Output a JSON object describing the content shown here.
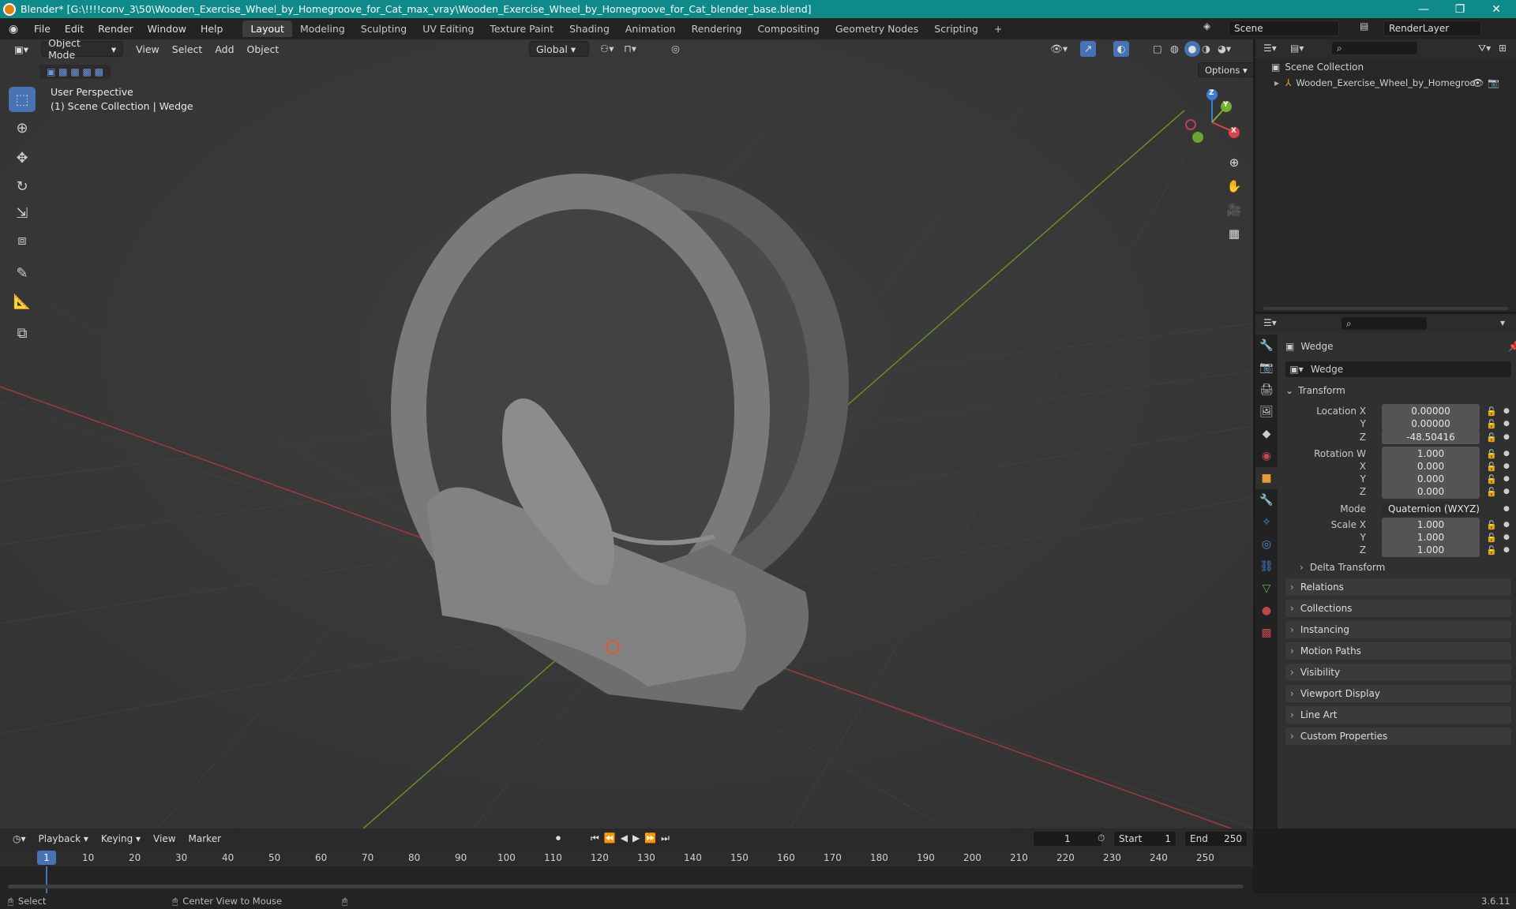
{
  "titlebar": {
    "title": "Blender* [G:\\!!!!conv_3\\50\\Wooden_Exercise_Wheel_by_Homegroove_for_Cat_max_vray\\Wooden_Exercise_Wheel_by_Homegroove_for_Cat_blender_base.blend]",
    "minimize": "—",
    "maximize": "❐",
    "close": "✕"
  },
  "menubar": {
    "items": [
      "File",
      "Edit",
      "Render",
      "Window",
      "Help"
    ],
    "workspaces": [
      "Layout",
      "Modeling",
      "Sculpting",
      "UV Editing",
      "Texture Paint",
      "Shading",
      "Animation",
      "Rendering",
      "Compositing",
      "Geometry Nodes",
      "Scripting"
    ],
    "active_workspace": "Layout",
    "add_tab": "+",
    "scene": "Scene",
    "render_layer": "RenderLayer"
  },
  "viewport": {
    "mode": "Object Mode",
    "menus": [
      "View",
      "Select",
      "Add",
      "Object"
    ],
    "transform_orientation": "Global",
    "options": "Options",
    "perspective_label": "User Perspective",
    "collection_label": "(1) Scene Collection | Wedge",
    "gizmo": {
      "x": "X",
      "y": "Y",
      "z": "Z"
    },
    "colors": {
      "x_axis": "#9e3a3f",
      "y_axis": "#6a8d23",
      "accent": "#4772b3",
      "gizmo_x": "#e0404a",
      "gizmo_y": "#73b02e",
      "gizmo_z": "#3a7fd6"
    }
  },
  "outliner": {
    "root": "Scene Collection",
    "item": "Wooden_Exercise_Wheel_by_Homegroo"
  },
  "properties": {
    "object_name": "Wedge",
    "data_name": "Wedge",
    "transform_header": "Transform",
    "location": {
      "label_x": "Location X",
      "label_y": "Y",
      "label_z": "Z",
      "x": "0.00000",
      "y": "0.00000",
      "z": "-48.50416"
    },
    "rotation": {
      "label_w": "Rotation W",
      "label_x": "X",
      "label_y": "Y",
      "label_z": "Z",
      "w": "1.000",
      "x": "0.000",
      "y": "0.000",
      "z": "0.000"
    },
    "mode_label": "Mode",
    "mode_value": "Quaternion (WXYZ)",
    "scale": {
      "label_x": "Scale X",
      "label_y": "Y",
      "label_z": "Z",
      "x": "1.000",
      "y": "1.000",
      "z": "1.000"
    },
    "delta_transform": "Delta Transform",
    "panels": [
      "Relations",
      "Collections",
      "Instancing",
      "Motion Paths",
      "Visibility",
      "Viewport Display",
      "Line Art",
      "Custom Properties"
    ]
  },
  "timeline": {
    "menus": [
      "Playback",
      "Keying",
      "View",
      "Marker"
    ],
    "current_frame": "1",
    "start_label": "Start",
    "start": "1",
    "end_label": "End",
    "end": "250",
    "ticks": [
      "1",
      "10",
      "20",
      "30",
      "40",
      "50",
      "60",
      "70",
      "80",
      "90",
      "100",
      "110",
      "120",
      "130",
      "140",
      "150",
      "160",
      "170",
      "180",
      "190",
      "200",
      "210",
      "220",
      "230",
      "240",
      "250"
    ]
  },
  "statusbar": {
    "select": "Select",
    "center_view": "Center View to Mouse",
    "version": "3.6.11"
  }
}
